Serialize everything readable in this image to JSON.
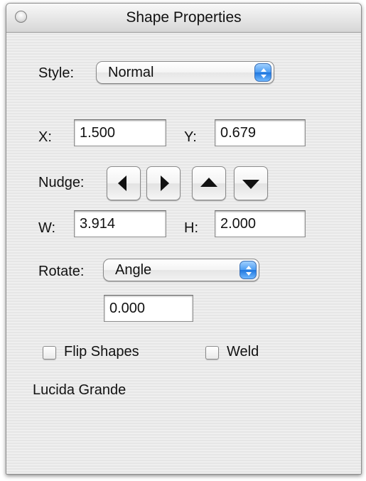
{
  "window": {
    "title": "Shape Properties"
  },
  "style": {
    "label": "Style:",
    "selected": "Normal"
  },
  "position": {
    "x_label": "X:",
    "x_value": "1.500",
    "y_label": "Y:",
    "y_value": "0.679"
  },
  "nudge": {
    "label": "Nudge:",
    "buttons": [
      "left-arrow-icon",
      "right-arrow-icon",
      "up-arrow-icon",
      "down-arrow-icon"
    ]
  },
  "size": {
    "w_label": "W:",
    "w_value": "3.914",
    "h_label": "H:",
    "h_value": "2.000"
  },
  "rotate": {
    "label": "Rotate:",
    "selected": "Angle",
    "value": "0.000"
  },
  "options": {
    "flip_label": "Flip Shapes",
    "flip_checked": false,
    "weld_label": "Weld",
    "weld_checked": false
  },
  "font_name": "Lucida Grande",
  "colors": {
    "popup_arrow_accent": "#4b9cf2"
  }
}
